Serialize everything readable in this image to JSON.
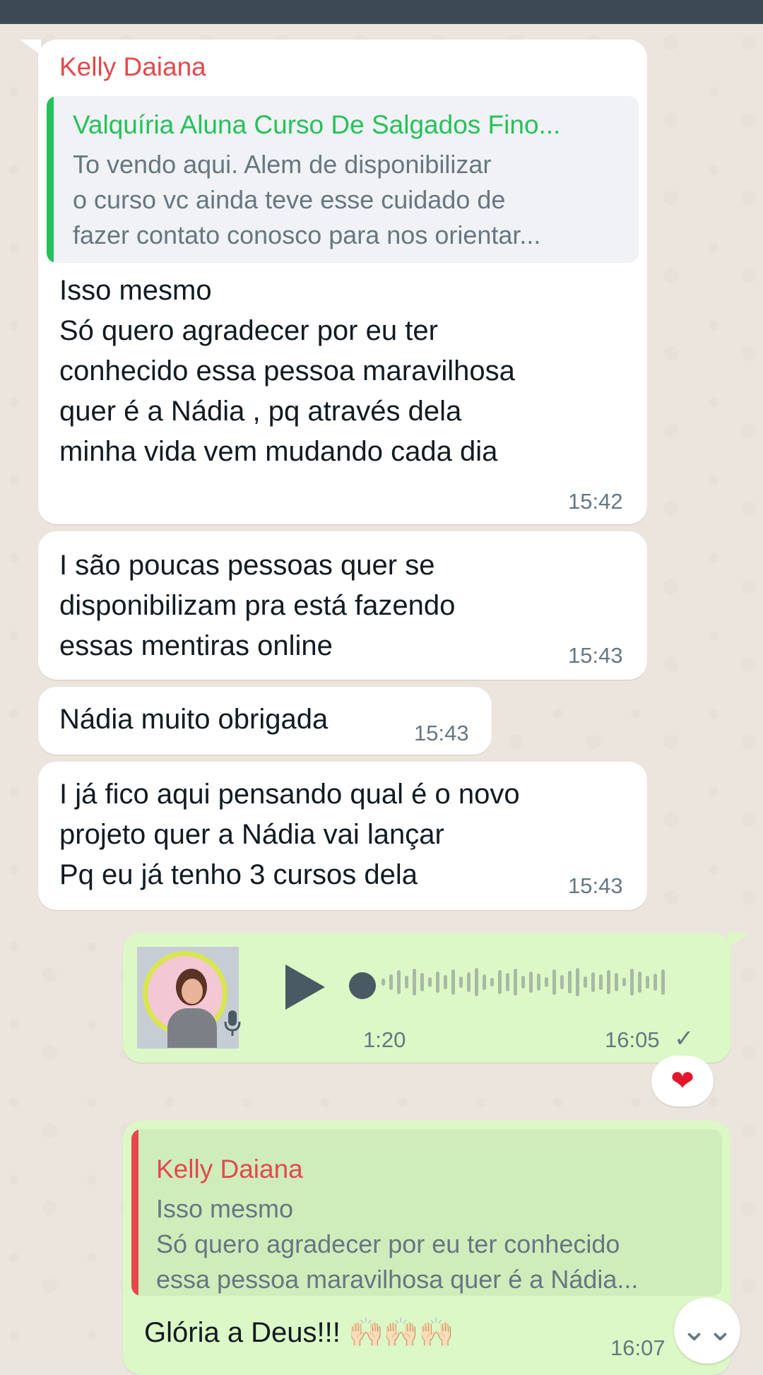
{
  "header": {
    "partial_text": ""
  },
  "messages": {
    "m1": {
      "sender": "Kelly Daiana",
      "quote_author": "Valquíria Aluna Curso De Salgados Fino...",
      "quote_text": "To vendo aqui. Alem de disponibilizar\no curso vc ainda teve esse cuidado de\nfazer contato conosco para nos orientar...",
      "text": "Isso mesmo\nSó quero agradecer por eu ter\nconhecido essa pessoa maravilhosa\nquer é a Nádia , pq através dela\nminha vida vem mudando cada dia",
      "time": "15:42"
    },
    "m2": {
      "text": "I são poucas pessoas quer se\ndisponibilizam pra está fazendo\nessas mentiras online",
      "time": "15:43"
    },
    "m3": {
      "text": "Nádia muito obrigada",
      "time": "15:43"
    },
    "m4": {
      "text": "I já fico aqui pensando qual é o novo\nprojeto quer a Nádia vai lançar\nPq eu já tenho 3 cursos dela",
      "time": "15:43"
    },
    "voice": {
      "duration": "1:20",
      "time": "16:05",
      "status": "✓",
      "reaction": "❤"
    },
    "m6": {
      "quote_author": "Kelly Daiana",
      "quote_text": "Isso mesmo\nSó quero agradecer por eu ter conhecido\nessa pessoa maravilhosa quer é a Nádia...",
      "text": "Glória a Deus!!! 🙌🏻🙌🏻🙌🏻",
      "time": "16:07"
    }
  },
  "scroll_button": {
    "icon": "⌄⌄"
  },
  "colors": {
    "incoming_bg": "#ffffff",
    "outgoing_bg": "#dcf8c6",
    "sender_red": "#e5484d",
    "quote_green": "#25c25a",
    "header_bg": "#3b4a53"
  }
}
